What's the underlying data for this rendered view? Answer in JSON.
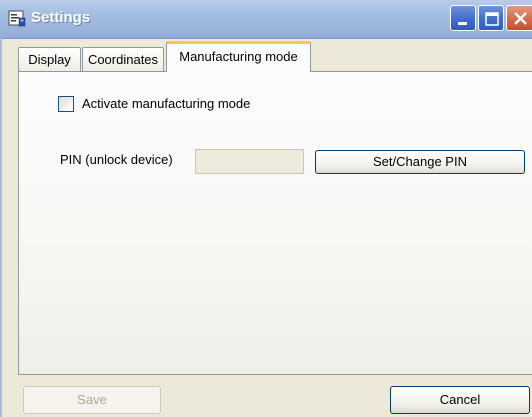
{
  "window": {
    "title": "Settings",
    "icon": "settings-app-icon",
    "controls": [
      "minimize-icon",
      "maximize-icon",
      "close-icon"
    ]
  },
  "tabs": [
    {
      "label": "Display",
      "selected": false
    },
    {
      "label": "Coordinates",
      "selected": false
    },
    {
      "label": "Manufacturing mode",
      "selected": true
    }
  ],
  "manufacturing": {
    "checkbox_label": "Activate manufacturing mode",
    "checkbox_checked": false,
    "pin_label": "PIN (unlock device)",
    "pin_value": "",
    "pin_enabled": false,
    "set_pin_label": "Set/Change PIN"
  },
  "footer": {
    "save_label": "Save",
    "save_enabled": false,
    "cancel_label": "Cancel"
  },
  "colors": {
    "titlebar": "#9cb5dd",
    "active_tab_accent": "#ffc83c",
    "window_bg": "#ece9d8",
    "close_button": "#d4694b",
    "button_border": "#003c74",
    "disabled_text": "#aca899"
  }
}
